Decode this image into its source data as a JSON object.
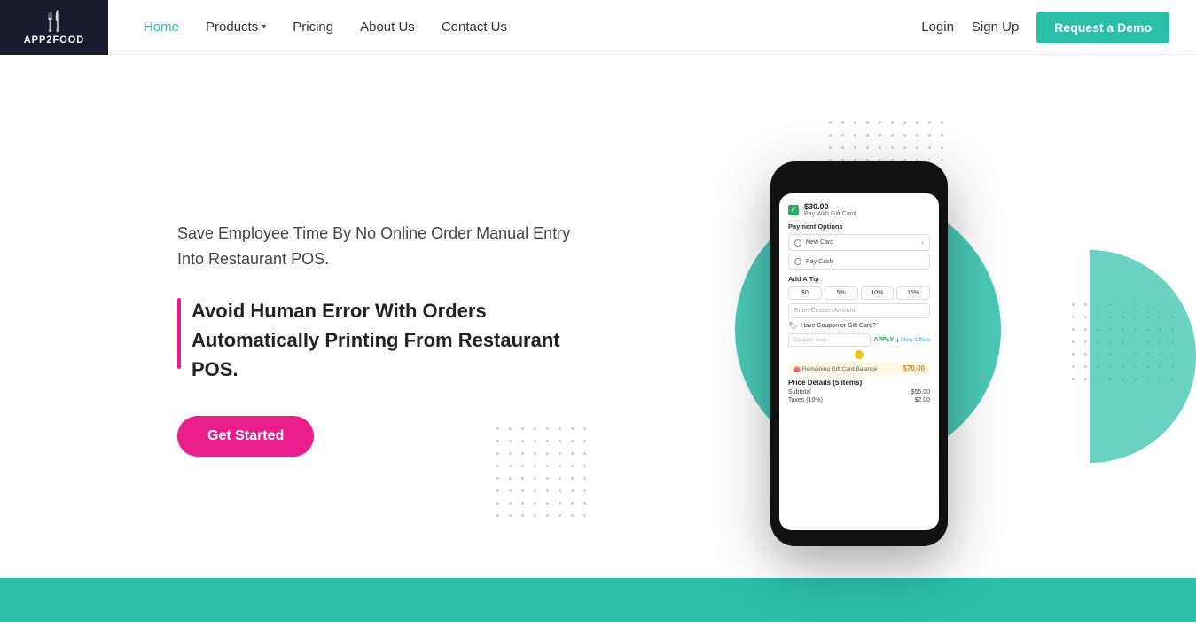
{
  "header": {
    "logo_text": "APP2FOOD",
    "nav": {
      "home": "Home",
      "products": "Products",
      "pricing": "Pricing",
      "about_us": "About Us",
      "contact_us": "Contact Us"
    },
    "login": "Login",
    "signup": "Sign Up",
    "request_demo": "Request a Demo"
  },
  "hero": {
    "text1": "Save Employee Time By No Online Order Manual Entry Into Restaurant POS.",
    "text2": "Avoid Human Error With Orders Automatically Printing From Restaurant POS.",
    "cta": "Get Started"
  },
  "phone": {
    "gift_card_amount": "$30.00",
    "gift_card_label": "Pay With Gift Card",
    "payment_options_title": "Payment Options",
    "new_card": "New Card",
    "pay_cash": "Pay Cash",
    "add_tip_title": "Add A Tip",
    "tip_0": "$0",
    "tip_5": "5%",
    "tip_10": "10%",
    "tip_15": "15%",
    "custom_tip_placeholder": "Enter Custom Amount",
    "coupon_title": "Have Coupon or Gift Card?",
    "coupon_placeholder": "Coupon code",
    "apply_btn": "APPLY",
    "view_offers": "View Offers",
    "gift_balance_label": "Remaining Gift Card Balance",
    "gift_balance_amount": "$70.00",
    "price_details_title": "Price Details (5 items)",
    "subtotal_label": "Subtotal",
    "subtotal_amount": "$55.00",
    "taxes_label": "Taxes (10%)",
    "taxes_amount": "$2.00"
  }
}
